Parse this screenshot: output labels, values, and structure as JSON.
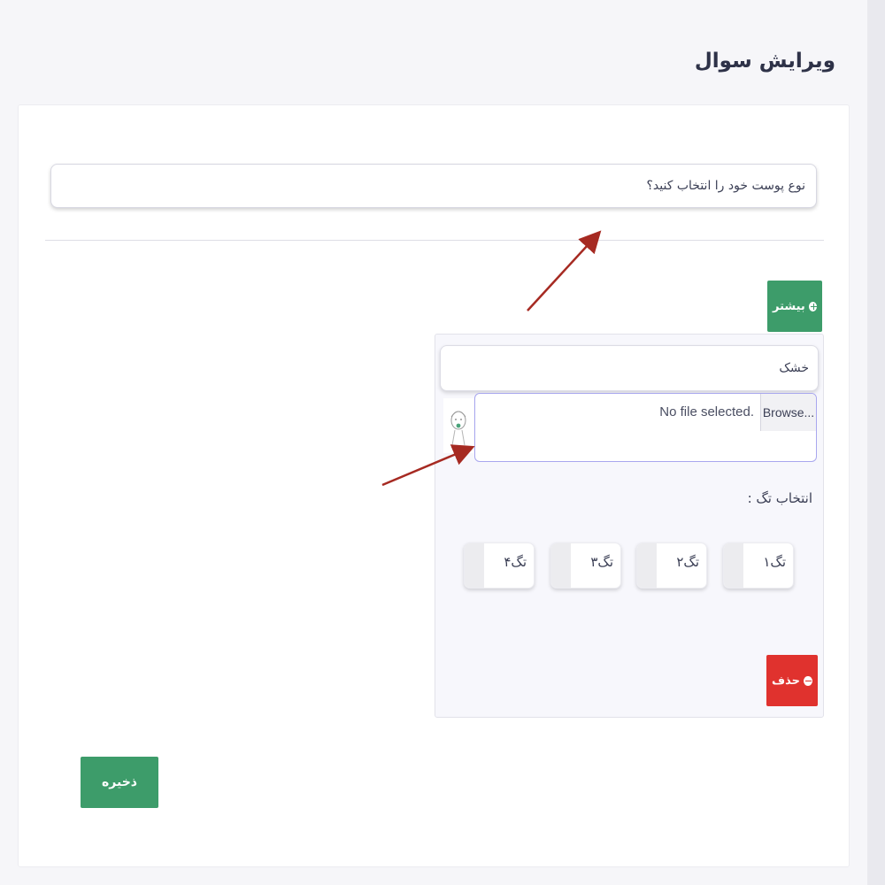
{
  "page": {
    "title": "ویرایش سوال"
  },
  "question": {
    "value": "نوع پوست خود را انتخاب کنید؟"
  },
  "more_button": {
    "label": "بیشتر",
    "icon": "plus-circle-icon"
  },
  "option": {
    "text": "خشک",
    "file": {
      "browse_label": "Browse...",
      "status": "No file selected."
    },
    "tags_label": "انتخاب تگ :",
    "tags": [
      {
        "label": "تگ۱"
      },
      {
        "label": "تگ۲"
      },
      {
        "label": "تگ۳"
      },
      {
        "label": "تگ۴"
      }
    ],
    "delete_button": {
      "label": "حذف",
      "icon": "minus-circle-icon"
    }
  },
  "save_button": {
    "label": "ذخیره"
  },
  "colors": {
    "green": "#3d9c6a",
    "red": "#e0322e",
    "arrow": "#a62a22"
  }
}
